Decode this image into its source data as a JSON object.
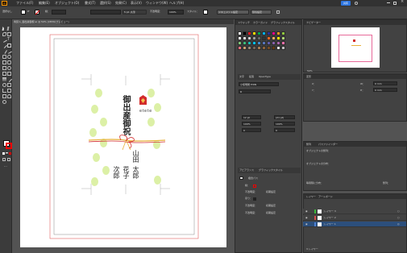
{
  "menu": {
    "items": [
      "ファイル(F)",
      "編集(E)",
      "オブジェクト(O)",
      "書式(T)",
      "選択(S)",
      "効果(C)",
      "表示(V)",
      "ウィンドウ(W)",
      "ヘルプ(H)"
    ],
    "share": "共有",
    "app_icon": "Ai"
  },
  "control": {
    "selection_label": "選択なし",
    "stroke_label": "線：",
    "brush_label": "5 pt. 丸筆",
    "opacity_label": "不透明度：",
    "opacity_value": "100%",
    "style_label": "スタイル：",
    "doc_setup": "ドキュメント設定",
    "prefs": "環境設定"
  },
  "document": {
    "tab_title": "寿熨斗_御出産御祝.ai @ 50% (CMYK/プレビュー)"
  },
  "swatches_panel": {
    "tabs": [
      "スウォッチ",
      "カラーガイド",
      "グラフィックスタイル"
    ],
    "colors": [
      "#ffffff",
      "#000000",
      "#ed1c24",
      "#ffdd00",
      "#00a651",
      "#00aeef",
      "#2e3192",
      "#ec008c",
      "#f7941d",
      "#8dc63f",
      "#ffffff",
      "#e6e6e6",
      "#cccccc",
      "#999999",
      "#666666",
      "#333333",
      "#f26522",
      "#fbaf5d",
      "#fff200",
      "#acd373",
      "#7cc576",
      "#3bb878",
      "#1abbb4",
      "#00bff3",
      "#438ccb",
      "#5674b9",
      "#605ca8",
      "#855fa8",
      "#a763a8",
      "#f06ea9",
      "#f26d7d",
      "#c69c6d",
      "#998675",
      "#736357",
      "#a67c52",
      "#8c6239",
      "#754c24",
      "#603913",
      "#e6e6e6",
      "#bdbdbd"
    ]
  },
  "char_panel": {
    "tabs": [
      "文字",
      "段落",
      "OpenType"
    ],
    "font_name": "小塚明朝 Pr6N",
    "font_style": "R",
    "font_size": "12 pt",
    "leading": "(21 pt)",
    "scale_v": "100%",
    "scale_h": "100%",
    "tracking": "0",
    "kerning": "0",
    "baseline": "0 pt",
    "rotation": "0°"
  },
  "appearance_panel": {
    "tabs": [
      "アピアランス",
      "グラフィックスタイル"
    ],
    "object_label": "複合パス",
    "stroke_label": "線：",
    "fill_label": "塗り：",
    "opacity_row": "不透明度：",
    "opacity_default": "初期設定",
    "rows": [
      {
        "label": "線：",
        "value": ""
      },
      {
        "label": "不透明度：",
        "value": "初期設定"
      },
      {
        "label": "塗り：",
        "value": ""
      },
      {
        "label": "不透明度：",
        "value": "初期設定"
      },
      {
        "label": "不透明度：",
        "value": "初期設定"
      }
    ]
  },
  "navigator_panel": {
    "tabs": [
      "ナビゲーター"
    ],
    "zoom": "50%"
  },
  "transform_panel": {
    "tab": "変形",
    "x_label": "X：",
    "y_label": "Y：",
    "w_label": "W：",
    "h_label": "H：",
    "w_value": "0 mm",
    "h_value": "0 mm"
  },
  "align_panel": {
    "tabs": [
      "整列",
      "パスファインダー"
    ],
    "obj_align": "オブジェクトの整列：",
    "obj_distribute": "オブジェクトの分布：",
    "spacing": "等間隔に分布：",
    "align_to": "整列："
  },
  "layers_panel": {
    "tabs": [
      "レイヤー",
      "アートボード"
    ],
    "layers": [
      "レイヤー 3",
      "レイヤー 2",
      "レイヤー 1"
    ],
    "footer": "3 レイヤー"
  },
  "artwork": {
    "title_vertical": "御出産御祝",
    "name1": "山田太郎",
    "name2": "花子",
    "name3": "次郎",
    "name_col1": "山田",
    "name_col2": "太郎",
    "name_col3": "花子",
    "name_col4": "次郎",
    "label_small": "etete",
    "accent_red": "#d22b2b",
    "accent_gold": "#e8b13a",
    "dot_green": "#d9ef9e"
  }
}
